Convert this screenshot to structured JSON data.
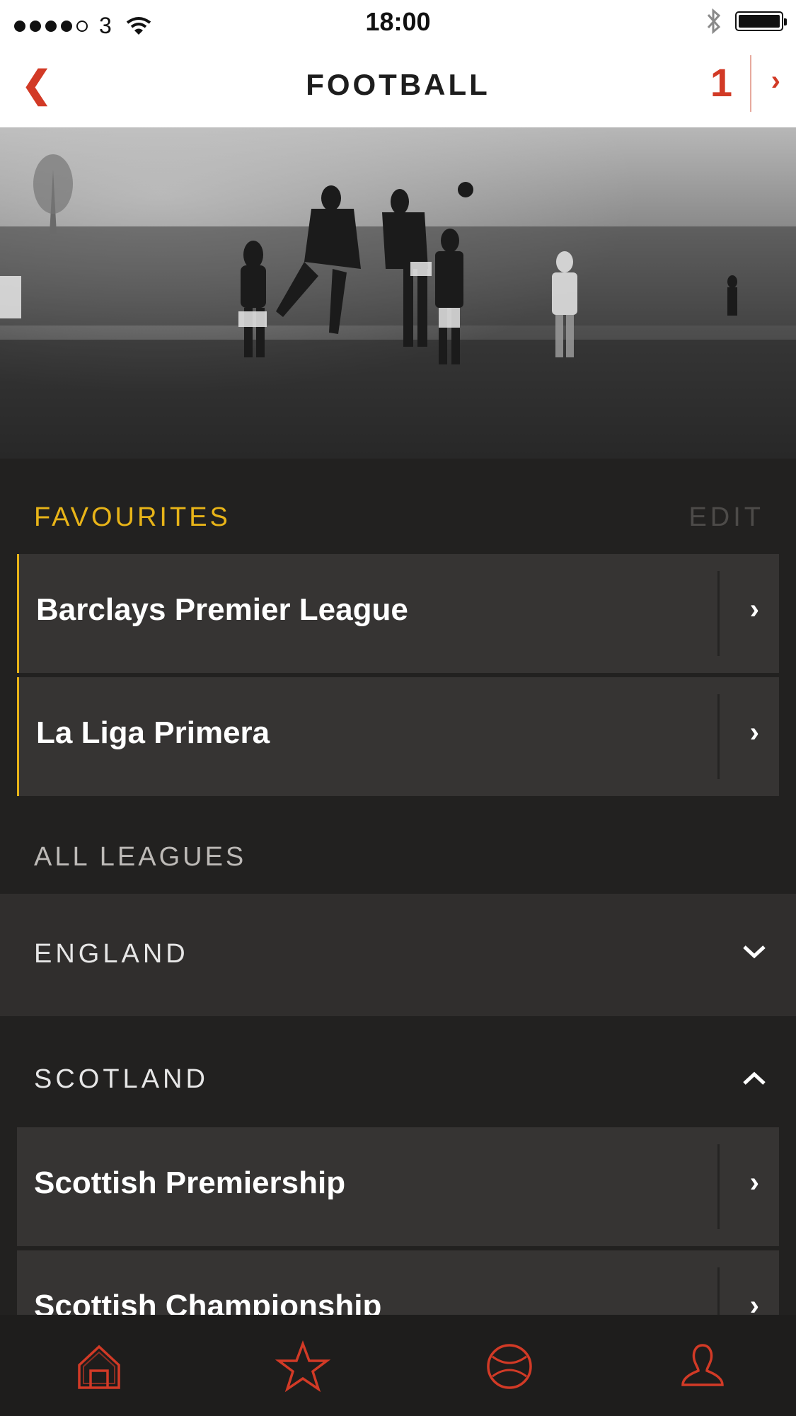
{
  "status_bar": {
    "carrier": "3",
    "time": "18:00"
  },
  "nav": {
    "back_icon": "chevron-left-icon",
    "title": "FOOTBALL",
    "count": "1",
    "next_icon": "chevron-right-icon"
  },
  "hero": {
    "description_icon": "football-photo"
  },
  "favourites": {
    "title": "FAVOURITES",
    "edit": "EDIT",
    "items": [
      {
        "label": "Barclays Premier League"
      },
      {
        "label": "La Liga Primera"
      }
    ]
  },
  "all_leagues": {
    "title": "ALL LEAGUES",
    "countries": [
      {
        "name": "ENGLAND",
        "state": "collapsed"
      },
      {
        "name": "SCOTLAND",
        "state": "expanded",
        "leagues": [
          {
            "label": "Scottish Premiership"
          },
          {
            "label": "Scottish Championship"
          }
        ]
      }
    ]
  },
  "tabbar": {
    "icons": [
      "home-icon",
      "star-icon",
      "ball-icon",
      "profile-icon"
    ]
  },
  "colors": {
    "accent_red": "#d23a26",
    "favourite_yellow": "#e8b418",
    "background": "#222120",
    "row_bg": "#363433"
  }
}
